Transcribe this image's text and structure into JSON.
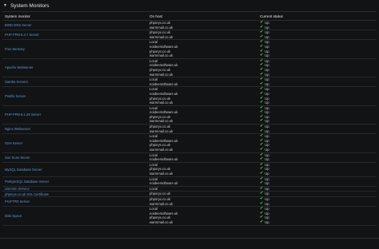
{
  "panel": {
    "title": "System Monitors",
    "collapse_icon": "caret-down"
  },
  "columns": {
    "monitor": "System monitor",
    "host": "On host",
    "status": "Current status"
  },
  "rows": [
    {
      "monitor": "BIND DNS Server",
      "hosts": [
        "phporyx.co.uk",
        "warmmail.co.uk"
      ]
    },
    {
      "monitor": "PHP-FPM 8.3.7 Server",
      "hosts": [
        "phporyx.co.uk",
        "warmmail.co.uk"
      ]
    },
    {
      "monitor": "Free Memory",
      "hosts": [
        "Local",
        "noideersoftware.uk",
        "phporyx.co.uk",
        "warmmail.co.uk"
      ]
    },
    {
      "monitor": "Apache Webserver",
      "hosts": [
        "Local",
        "noideersoftware.uk",
        "phporyx.co.uk",
        "warmmail.co.uk"
      ]
    },
    {
      "monitor": "Samba Servers",
      "hosts": [
        "Local",
        "noideersoftware.uk"
      ]
    },
    {
      "monitor": "Postfix Server",
      "hosts": [
        "Local",
        "noideersoftware.uk",
        "phporyx.co.uk",
        "warmmail.co.uk"
      ]
    },
    {
      "monitor": "PHP-FPM 8.1.29 Server",
      "hosts": [
        "Local",
        "noideersoftware.uk",
        "phporyx.co.uk",
        "warmmail.co.uk"
      ]
    },
    {
      "monitor": "Nginx Webserver",
      "hosts": [
        "phporyx.co.uk",
        "warmmail.co.uk"
      ]
    },
    {
      "monitor": "SSH Server",
      "hosts": [
        "Local",
        "noideersoftware.uk",
        "phporyx.co.uk",
        "warmmail.co.uk"
      ]
    },
    {
      "monitor": "Sun Scan Server",
      "hosts": [
        "Local",
        "noideersoftware.uk"
      ]
    },
    {
      "monitor": "MySQL Database Server",
      "hosts": [
        "Local",
        "phporyx.co.uk",
        "warmmail.co.uk"
      ]
    },
    {
      "monitor": "PostgreSQL Database Server",
      "hosts": [
        "Local",
        "noideersoftware.uk"
      ]
    },
    {
      "monitor": "Usermin Service",
      "hosts": [
        "Local"
      ]
    },
    {
      "monitor": "phporyx.co.uk SSL Certificate",
      "hosts": [
        "phporyx.co.uk"
      ]
    },
    {
      "monitor": "ProFTPD Server",
      "hosts": [
        "phporyx.co.uk",
        "warmmail.co.uk"
      ]
    },
    {
      "monitor": "Disk Space",
      "hosts": [
        "Local",
        "noideersoftware.uk",
        "phporyx.co.uk",
        "warmmail.co.uk"
      ]
    }
  ],
  "status_label": "Up",
  "status_icon": "check-icon",
  "colors": {
    "link": "#5b9ad5",
    "ok": "#3fb950",
    "background": "#121315"
  }
}
